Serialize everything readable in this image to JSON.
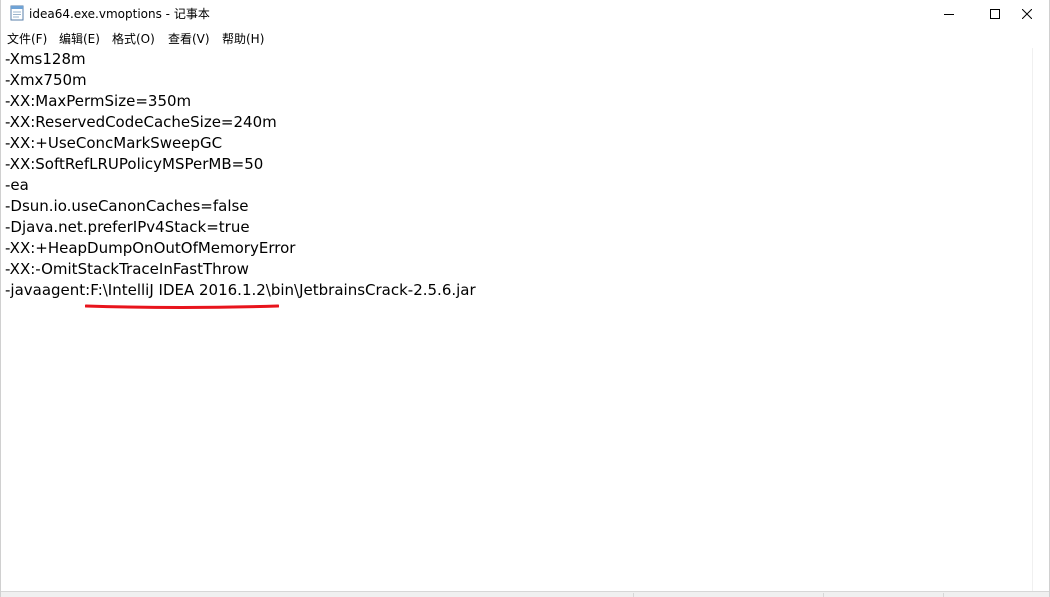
{
  "window": {
    "title": "idea64.exe.vmoptions - 记事本",
    "icon": "notepad-icon",
    "controls": [
      "minimize-icon",
      "maximize-icon",
      "close-icon"
    ]
  },
  "menu": {
    "items": [
      {
        "label": "文件(F)"
      },
      {
        "label": "编辑(E)"
      },
      {
        "label": "格式(O)"
      },
      {
        "label": "查看(V)"
      },
      {
        "label": "帮助(H)"
      }
    ]
  },
  "editor": {
    "lines": [
      "-Xms128m",
      "-Xmx750m",
      "-XX:MaxPermSize=350m",
      "-XX:ReservedCodeCacheSize=240m",
      "-XX:+UseConcMarkSweepGC",
      "-XX:SoftRefLRUPolicyMSPerMB=50",
      "-ea",
      "-Dsun.io.useCanonCaches=false",
      "-Djava.net.preferIPv4Stack=true",
      "-XX:+HeapDumpOnOutOfMemoryError",
      "-XX:-OmitStackTraceInFastThrow",
      "-javaagent:F:\\IntelliJ IDEA 2016.1.2\\bin\\JetbrainsCrack-2.5.6.jar"
    ],
    "annotation_color": "#e8141c"
  }
}
